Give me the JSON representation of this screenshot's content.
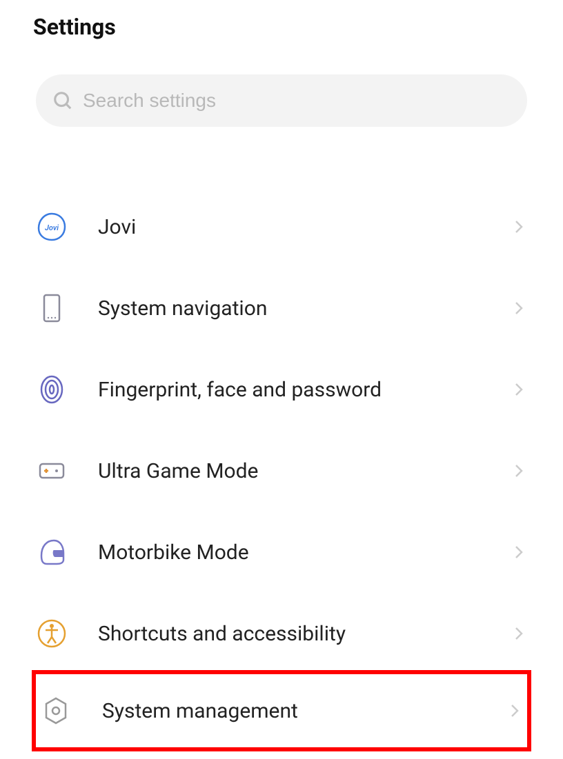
{
  "header": {
    "title": "Settings"
  },
  "search": {
    "placeholder": "Search settings"
  },
  "items": [
    {
      "id": "jovi",
      "label": "Jovi"
    },
    {
      "id": "system-navigation",
      "label": "System navigation"
    },
    {
      "id": "fingerprint",
      "label": "Fingerprint, face and password"
    },
    {
      "id": "ultra-game-mode",
      "label": "Ultra Game Mode"
    },
    {
      "id": "motorbike-mode",
      "label": "Motorbike Mode"
    },
    {
      "id": "shortcuts-accessibility",
      "label": "Shortcuts and accessibility"
    },
    {
      "id": "system-management",
      "label": "System management"
    }
  ],
  "highlighted_item": "system-management"
}
